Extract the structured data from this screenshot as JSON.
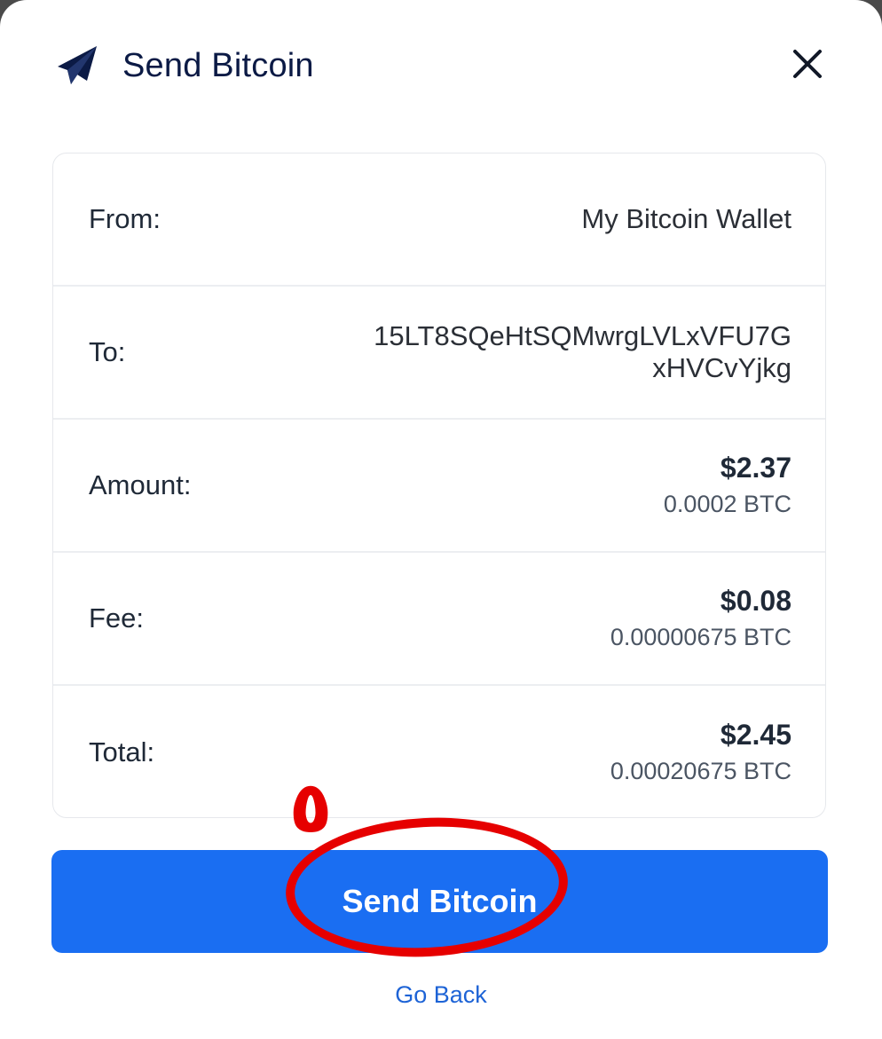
{
  "header": {
    "title": "Send Bitcoin",
    "icon": "paper-plane-icon",
    "close_icon": "close-icon"
  },
  "details": {
    "from": {
      "label": "From:",
      "value": "My Bitcoin Wallet"
    },
    "to": {
      "label": "To:",
      "value": "15LT8SQeHtSQMwrgLVLxVFU7GxHVCvYjkg"
    },
    "amount": {
      "label": "Amount:",
      "usd": "$2.37",
      "btc": "0.0002 BTC"
    },
    "fee": {
      "label": "Fee:",
      "usd": "$0.08",
      "btc": "0.00000675 BTC"
    },
    "total": {
      "label": "Total:",
      "usd": "$2.45",
      "btc": "0.00020675 BTC"
    }
  },
  "actions": {
    "send_label": "Send Bitcoin",
    "back_label": "Go Back"
  },
  "annotation": {
    "number": "٥",
    "color": "#e60000"
  },
  "colors": {
    "primary": "#1a6ef2",
    "link": "#1d63d6",
    "title": "#0b1a45"
  }
}
